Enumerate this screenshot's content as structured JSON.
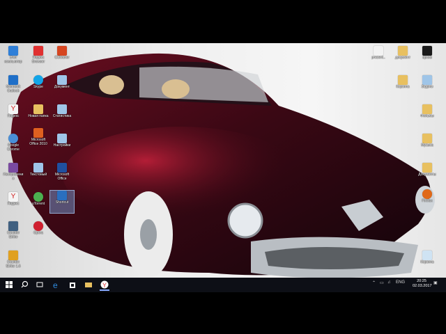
{
  "desktop": {
    "icons": [
      {
        "label": "Этот компьютер",
        "color": "#2f7fd8"
      },
      {
        "label": "Яндекс Browser",
        "color": "#e03030"
      },
      {
        "label": "CCleaner",
        "color": "#d64520"
      },
      {
        "label": "Microsoft Outlook",
        "color": "#1f6fc8"
      },
      {
        "label": "Skype",
        "color": "#12a5e8"
      },
      {
        "label": "Документ",
        "color": "#9fc5e8"
      },
      {
        "label": "Яндекс",
        "color": "#f4f4f4"
      },
      {
        "label": "Новая папка",
        "color": "#e8c060"
      },
      {
        "label": "Статистика",
        "color": "#9fc5e8"
      },
      {
        "label": "Google Chrome",
        "color": "#4a8fd8"
      },
      {
        "label": "Microsoft Office 2010",
        "color": "#e06020"
      },
      {
        "label": "Настройки",
        "color": "#9fc5e8"
      },
      {
        "label": "Изображения",
        "color": "#7a4aa0"
      },
      {
        "label": "Текстовый",
        "color": "#9fc5e8"
      },
      {
        "label": "Microsoft Office",
        "color": "#2050a0"
      },
      {
        "label": "Яндекс",
        "color": "#f4f4f4"
      },
      {
        "label": "uTorrent",
        "color": "#4caf50"
      },
      {
        "label": "Shortcut",
        "color": "#2a6fbf"
      },
      {
        "label": "Counter Strike",
        "color": "#406080"
      },
      {
        "label": "Opera",
        "color": "#d02030"
      },
      {
        "label": "Counter Strike 1.6",
        "color": "#e0a020"
      },
      {
        "label": "prezent..",
        "color": "#f2f2f2"
      },
      {
        "label": "документ",
        "color": "#e8c060"
      },
      {
        "label": "архив",
        "color": "#1a1a1a"
      },
      {
        "label": "Корзина",
        "color": "#e8c060"
      },
      {
        "label": "Задачи",
        "color": "#9fc5e8"
      },
      {
        "label": "Фильмы",
        "color": "#e8c060"
      },
      {
        "label": "Музыка",
        "color": "#e8c060"
      },
      {
        "label": "Документы",
        "color": "#e8c060"
      },
      {
        "label": "Firefox",
        "color": "#e06818"
      },
      {
        "label": "Корзина",
        "color": "#cfe3f3"
      }
    ]
  },
  "taskbar": {
    "apps": [
      {
        "name": "start",
        "color": "#ffffff"
      },
      {
        "name": "search",
        "color": "#ffffff"
      },
      {
        "name": "task-view",
        "color": "#ffffff"
      },
      {
        "name": "edge",
        "color": "#2f8ce0"
      },
      {
        "name": "store",
        "color": "#ffffff"
      },
      {
        "name": "explorer",
        "color": "#e8c060"
      },
      {
        "name": "yandex",
        "color": "#e03030"
      }
    ],
    "lang": "ENG",
    "time": "20:25",
    "date": "02.03.2017"
  }
}
